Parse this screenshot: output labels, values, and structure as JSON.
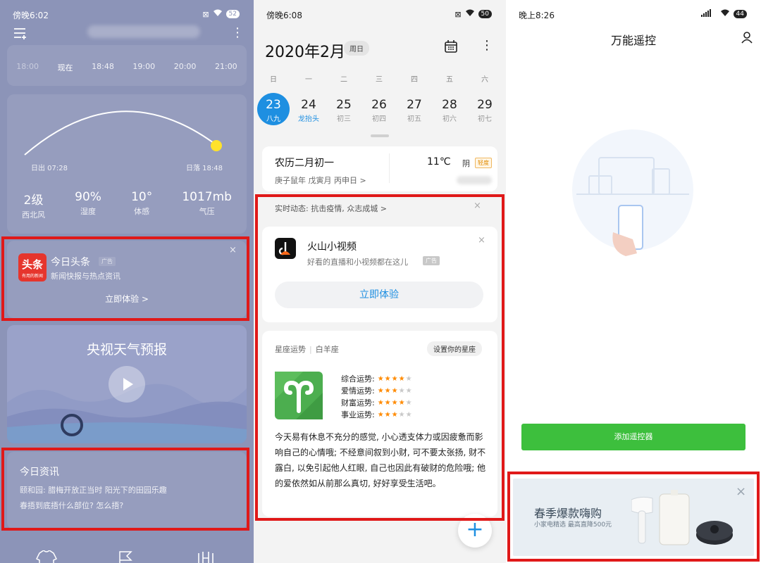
{
  "weather": {
    "status_time": "傍晚6:02",
    "battery": "52",
    "hours": [
      "18:00",
      "现在",
      "18:48",
      "19:00",
      "20:00",
      "21:00"
    ],
    "sunrise": "日出 07:28",
    "sunset": "日落 18:48",
    "stats": [
      {
        "value": "2级",
        "label": "西北风"
      },
      {
        "value": "90%",
        "label": "湿度"
      },
      {
        "value": "10°",
        "label": "体感"
      },
      {
        "value": "1017mb",
        "label": "气压"
      }
    ],
    "ad": {
      "logo_text": "头条",
      "logo_sub": "有用的新闻",
      "title": "今日头条",
      "tag": "广告",
      "desc": "新闻快报与热点资讯",
      "cta": "立即体验 >"
    },
    "video_title": "央视天气预报",
    "news": {
      "title": "今日资讯",
      "items": [
        "颐和园: 腊梅开放正当时 阳光下的田园乐趣",
        "春捂到底捂什么部位? 怎么捂?"
      ]
    }
  },
  "calendar": {
    "status_time": "傍晚6:08",
    "battery": "50",
    "month_title": "2020年2月",
    "today_btn": "周日",
    "weekdays": [
      "日",
      "一",
      "二",
      "三",
      "四",
      "五",
      "六"
    ],
    "days": [
      {
        "num": "23",
        "lunar": "八九"
      },
      {
        "num": "24",
        "lunar": "龙抬头"
      },
      {
        "num": "25",
        "lunar": "初三"
      },
      {
        "num": "26",
        "lunar": "初四"
      },
      {
        "num": "27",
        "lunar": "初五"
      },
      {
        "num": "28",
        "lunar": "初六"
      },
      {
        "num": "29",
        "lunar": "初七"
      }
    ],
    "lunar_date": "农历二月初一",
    "ganzhi": "庚子鼠年 戊寅月 丙申日 >",
    "temp": "11℃",
    "weather": "阴",
    "aqi": "轻度",
    "live_news": "实时动态: 抗击疫情, 众志成城 >",
    "ad": {
      "title": "火山小视频",
      "desc": "好看的直播和小视频都在这儿",
      "tag": "广告",
      "cta": "立即体验"
    },
    "horoscope": {
      "title": "星座运势",
      "sign": "白羊座",
      "set_btn": "设置你的星座",
      "rows": [
        {
          "label": "综合运势:",
          "stars": 4
        },
        {
          "label": "爱情运势:",
          "stars": 3
        },
        {
          "label": "财富运势:",
          "stars": 4
        },
        {
          "label": "事业运势:",
          "stars": 3
        }
      ],
      "text": "今天易有休息不充分的感觉, 小心透支体力或因疲惫而影响自己的心情哦; 不经意间叙到小财, 可不要太张扬, 财不露白, 以免引起他人红眼, 自己也因此有破财的危险哦; 他的爱依然如从前那么真切, 好好享受生活吧。"
    },
    "fab": "+"
  },
  "remote": {
    "status_time": "晚上8:26",
    "battery": "44",
    "title": "万能遥控",
    "add_btn": "添加遥控器",
    "ad": {
      "title": "春季爆款嗨购",
      "sub": "小家电精选 最高直降500元"
    }
  },
  "colors": {
    "red_highlight": "#e01919",
    "calendar_blue": "#1e8fe1",
    "remote_green": "#3dbf3d",
    "weather_bg": "#8c94b8"
  }
}
